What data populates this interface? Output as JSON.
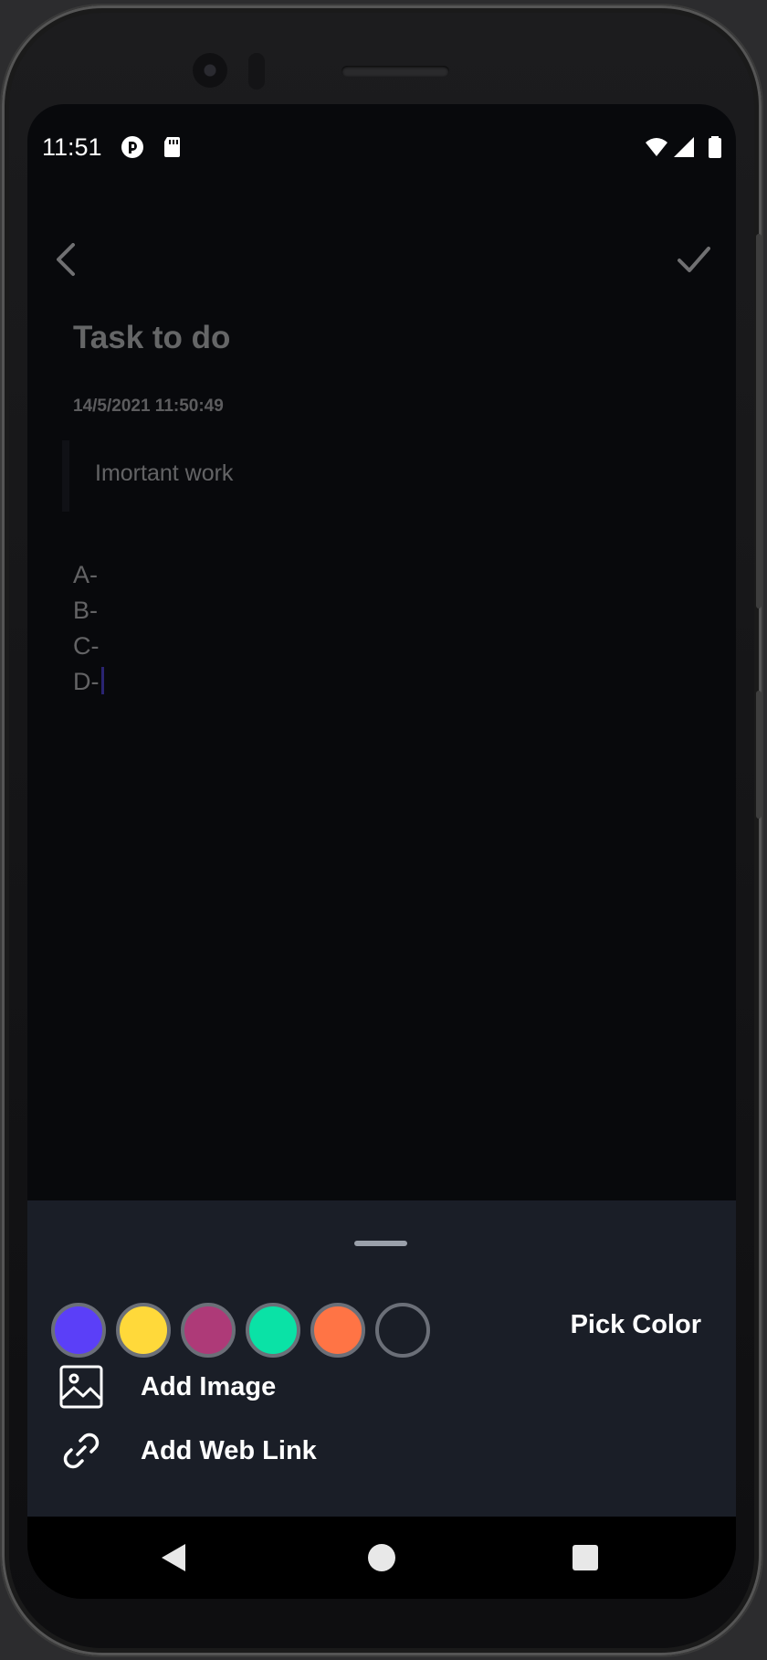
{
  "status_bar": {
    "time": "11:51",
    "icons": [
      "app-notification-icon",
      "sd-card-icon",
      "wifi-icon",
      "cell-signal-icon",
      "battery-icon"
    ]
  },
  "toolbar": {
    "back_icon": "chevron-left-icon",
    "save_icon": "checkmark-icon"
  },
  "note": {
    "title": "Task to do",
    "date": "14/5/2021 11:50:49",
    "subtitle": "Imortant work",
    "lines": [
      "A-",
      "B-",
      "C-",
      "D-"
    ]
  },
  "bottom_sheet": {
    "colors": [
      "#5b3ff8",
      "#ffd93a",
      "#ae3a78",
      "#0ae2a6",
      "#ff7445",
      "#1a1e27"
    ],
    "selected_color_index": 5,
    "pick_color_label": "Pick Color",
    "add_image_label": "Add Image",
    "add_link_label": "Add Web Link"
  },
  "nav_bar": {
    "icons": [
      "nav-back-icon",
      "nav-home-icon",
      "nav-recents-icon"
    ]
  }
}
